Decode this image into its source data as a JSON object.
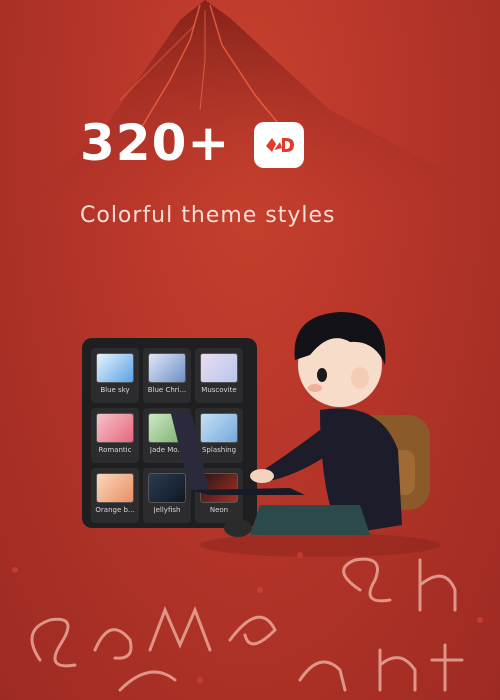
{
  "hero": {
    "headline": "320+",
    "subtitle": "Colorful theme styles",
    "logo_icon": "app-logo-icon"
  },
  "theme_panel": {
    "tiles": [
      {
        "label": "Blue sky",
        "colors": [
          "#e8f3fb",
          "#5aa2e6"
        ]
      },
      {
        "label": "Blue Chri...",
        "colors": [
          "#dfe7f5",
          "#6f8fc8"
        ]
      },
      {
        "label": "Muscovite",
        "colors": [
          "#e9ddf2",
          "#b7c6ea"
        ]
      },
      {
        "label": "Romantic",
        "colors": [
          "#f7c3cc",
          "#e5677a"
        ]
      },
      {
        "label": "Jade Mo...",
        "colors": [
          "#cfe8c6",
          "#76b06b"
        ]
      },
      {
        "label": "Splashing",
        "colors": [
          "#c6e1f5",
          "#74a8dc"
        ]
      },
      {
        "label": "Orange b...",
        "colors": [
          "#fbd7bf",
          "#e89060"
        ]
      },
      {
        "label": "Jellyfish",
        "colors": [
          "#2a3c52",
          "#0f1822"
        ]
      },
      {
        "label": "Neon",
        "colors": [
          "#2a1515",
          "#a43226"
        ]
      }
    ]
  },
  "colors": {
    "background": "#b8362a",
    "panel": "#1f1f21",
    "accent": "#e23b2d"
  },
  "decor": {
    "neon_words": [
      "Same Sh",
      "rent"
    ]
  }
}
